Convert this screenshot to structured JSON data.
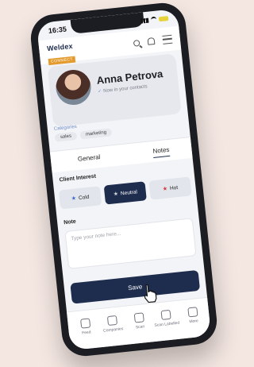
{
  "status": {
    "time": "16:35"
  },
  "app": {
    "logo_text": "Weldex",
    "logo_badge": "CONNECT"
  },
  "contact": {
    "name": "Anna Petrova",
    "note": "Now in your contacts"
  },
  "categories": {
    "label": "Categories",
    "chips": [
      "sales",
      "marketing"
    ]
  },
  "tabs": [
    {
      "label": "General"
    },
    {
      "label": "Notes"
    }
  ],
  "client_interest": {
    "label": "Client Interest",
    "options": [
      {
        "label": "Cold",
        "star_color": "#3c6ec7"
      },
      {
        "label": "Neutral",
        "star_color": "#cfd3db",
        "selected": true
      },
      {
        "label": "Hot",
        "star_color": "#d6383f"
      }
    ]
  },
  "note": {
    "label": "Note",
    "placeholder": "Type your note here..."
  },
  "save": {
    "label": "Save"
  },
  "nav": [
    {
      "label": "Feed"
    },
    {
      "label": "Companies"
    },
    {
      "label": "Scan"
    },
    {
      "label": "Scan Labelled"
    },
    {
      "label": "More"
    }
  ],
  "colors": {
    "brand_dark": "#1e2c4e",
    "accent_orange": "#e49a2c",
    "background": "#f4e7e2"
  }
}
